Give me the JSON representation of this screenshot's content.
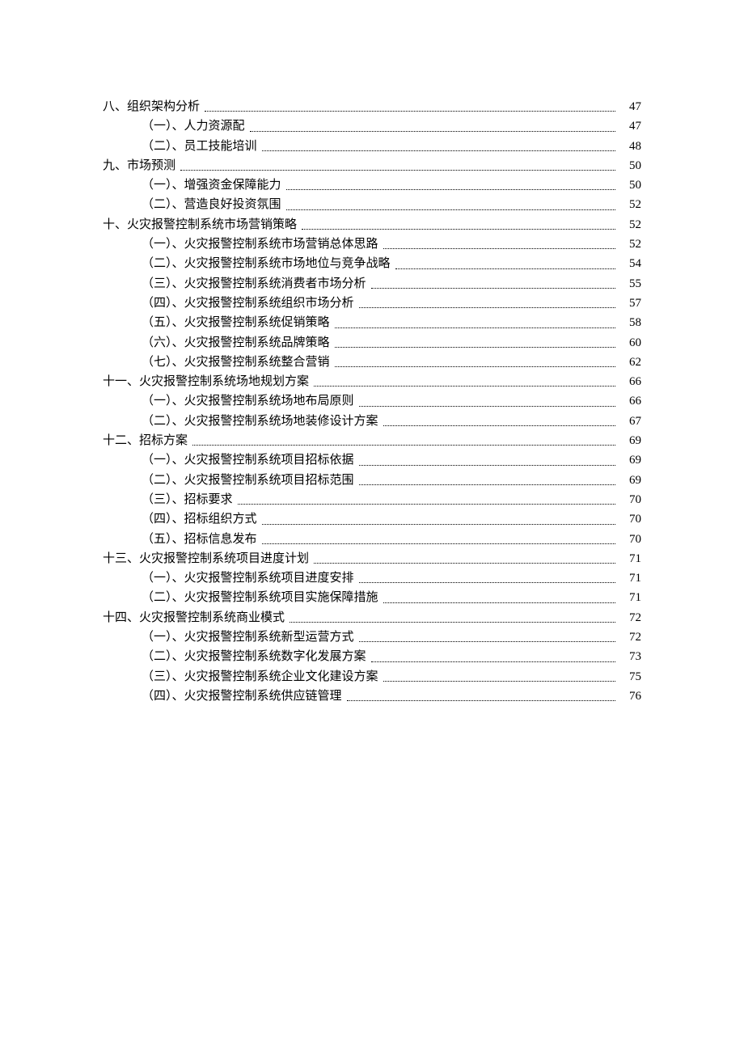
{
  "toc": [
    {
      "level": 1,
      "title": "八、组织架构分析",
      "page": "47",
      "name": "toc-section-8"
    },
    {
      "level": 2,
      "title": "（一）、人力资源配",
      "page": "47",
      "name": "toc-section-8-1"
    },
    {
      "level": 2,
      "title": "（二）、员工技能培训",
      "page": "48",
      "name": "toc-section-8-2"
    },
    {
      "level": 1,
      "title": "九、市场预测",
      "page": "50",
      "name": "toc-section-9"
    },
    {
      "level": 2,
      "title": "（一）、增强资金保障能力",
      "page": "50",
      "name": "toc-section-9-1"
    },
    {
      "level": 2,
      "title": "（二）、营造良好投资氛围",
      "page": "52",
      "name": "toc-section-9-2"
    },
    {
      "level": 1,
      "title": "十、火灾报警控制系统市场营销策略",
      "page": "52",
      "name": "toc-section-10"
    },
    {
      "level": 2,
      "title": "（一）、火灾报警控制系统市场营销总体思路",
      "page": "52",
      "name": "toc-section-10-1"
    },
    {
      "level": 2,
      "title": "（二）、火灾报警控制系统市场地位与竞争战略",
      "page": "54",
      "name": "toc-section-10-2"
    },
    {
      "level": 2,
      "title": "（三）、火灾报警控制系统消费者市场分析",
      "page": "55",
      "name": "toc-section-10-3"
    },
    {
      "level": 2,
      "title": "（四）、火灾报警控制系统组织市场分析",
      "page": "57",
      "name": "toc-section-10-4"
    },
    {
      "level": 2,
      "title": "（五）、火灾报警控制系统促销策略",
      "page": "58",
      "name": "toc-section-10-5"
    },
    {
      "level": 2,
      "title": "（六）、火灾报警控制系统品牌策略",
      "page": "60",
      "name": "toc-section-10-6"
    },
    {
      "level": 2,
      "title": "（七）、火灾报警控制系统整合营销",
      "page": "62",
      "name": "toc-section-10-7"
    },
    {
      "level": 1,
      "title": "十一、火灾报警控制系统场地规划方案",
      "page": "66",
      "name": "toc-section-11"
    },
    {
      "level": 2,
      "title": "（一）、火灾报警控制系统场地布局原则",
      "page": "66",
      "name": "toc-section-11-1"
    },
    {
      "level": 2,
      "title": "（二）、火灾报警控制系统场地装修设计方案",
      "page": "67",
      "name": "toc-section-11-2"
    },
    {
      "level": 1,
      "title": "十二、招标方案",
      "page": "69",
      "name": "toc-section-12"
    },
    {
      "level": 2,
      "title": "（一）、火灾报警控制系统项目招标依据",
      "page": "69",
      "name": "toc-section-12-1"
    },
    {
      "level": 2,
      "title": "（二）、火灾报警控制系统项目招标范围",
      "page": "69",
      "name": "toc-section-12-2"
    },
    {
      "level": 2,
      "title": "（三）、招标要求",
      "page": "70",
      "name": "toc-section-12-3"
    },
    {
      "level": 2,
      "title": "（四）、招标组织方式",
      "page": "70",
      "name": "toc-section-12-4"
    },
    {
      "level": 2,
      "title": "（五）、招标信息发布",
      "page": "70",
      "name": "toc-section-12-5"
    },
    {
      "level": 1,
      "title": "十三、火灾报警控制系统项目进度计划",
      "page": "71",
      "name": "toc-section-13"
    },
    {
      "level": 2,
      "title": "（一）、火灾报警控制系统项目进度安排",
      "page": "71",
      "name": "toc-section-13-1"
    },
    {
      "level": 2,
      "title": "（二）、火灾报警控制系统项目实施保障措施",
      "page": "71",
      "name": "toc-section-13-2"
    },
    {
      "level": 1,
      "title": "十四、火灾报警控制系统商业模式",
      "page": "72",
      "name": "toc-section-14"
    },
    {
      "level": 2,
      "title": "（一）、火灾报警控制系统新型运营方式",
      "page": "72",
      "name": "toc-section-14-1"
    },
    {
      "level": 2,
      "title": "（二）、火灾报警控制系统数字化发展方案",
      "page": "73",
      "name": "toc-section-14-2"
    },
    {
      "level": 2,
      "title": "（三）、火灾报警控制系统企业文化建设方案",
      "page": "75",
      "name": "toc-section-14-3"
    },
    {
      "level": 2,
      "title": "（四）、火灾报警控制系统供应链管理",
      "page": "76",
      "name": "toc-section-14-4"
    }
  ]
}
